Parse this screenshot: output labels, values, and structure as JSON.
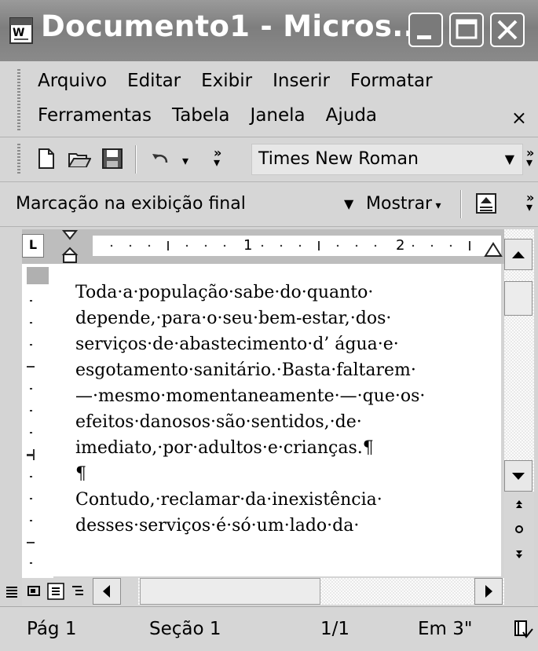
{
  "window": {
    "title": "Documento1 - Micros..."
  },
  "menu": {
    "row1": [
      "Arquivo",
      "Editar",
      "Exibir",
      "Inserir",
      "Formatar"
    ],
    "row2": [
      "Ferramentas",
      "Tabela",
      "Janela",
      "Ajuda"
    ],
    "close": "×"
  },
  "toolbar": {
    "font": "Times New Roman"
  },
  "review": {
    "markup": "Marcação na exibição final",
    "show": "Mostrar"
  },
  "ruler": {
    "mark1": "1",
    "mark2": "2"
  },
  "document": {
    "lines": [
      "Toda·a·população·sabe·do·quanto·",
      "depende,·para·o·seu·bem-estar,·dos·",
      "serviços·de·abastecimento·d’ água·e·",
      "esgotamento·sanitário.·Basta·faltarem·",
      "—·mesmo·momentaneamente·—·que·os·",
      "efeitos·danosos·são·sentidos,·de·",
      "imediato,·por·adultos·e·crianças.¶",
      "¶",
      "Contudo,·reclamar·da·inexistência·",
      "desses·serviços·é·só·um·lado·da·"
    ]
  },
  "status": {
    "page": "Pág 1",
    "section": "Seção 1",
    "pages": "1/1",
    "position": "Em 3\""
  },
  "colors": {
    "title_bar": "#8a8a8a",
    "chrome": "#d6d6d6",
    "page": "#ffffff"
  }
}
